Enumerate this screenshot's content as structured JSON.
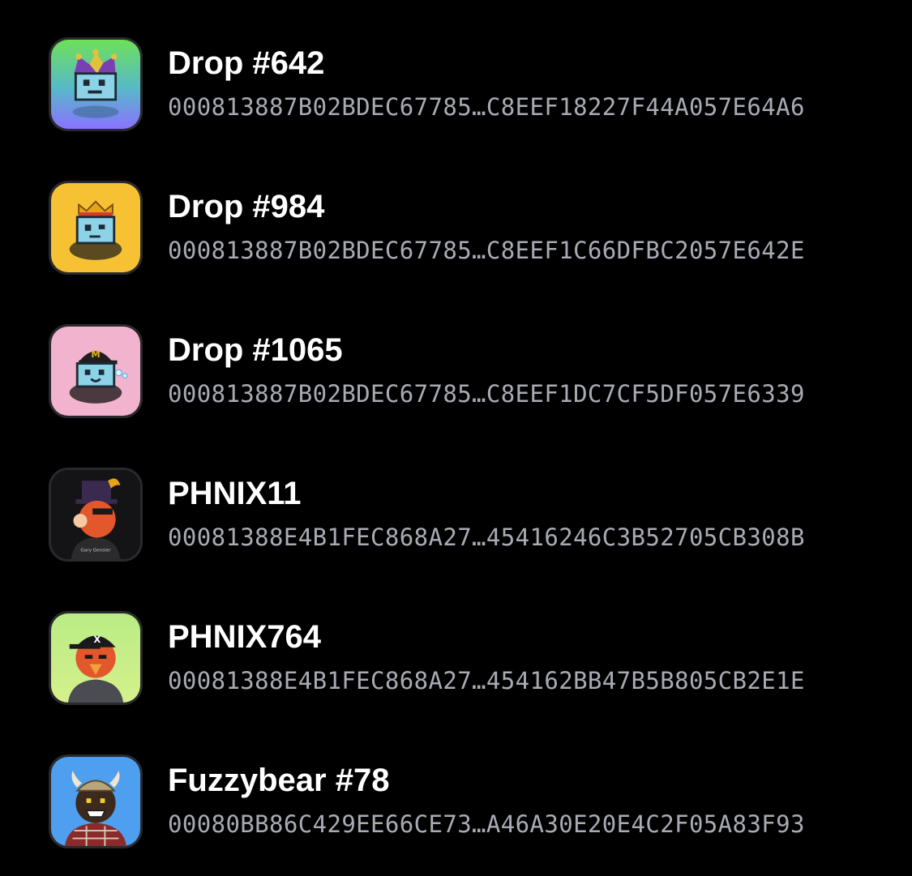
{
  "items": [
    {
      "name": "Drop #642",
      "id": "000813887B02BDEC67785…C8EEF18227F44A057E64A6",
      "icon": "jester-drop-avatar-icon",
      "bg_top": "#6ee05a",
      "bg_bottom": "#8a72ff"
    },
    {
      "name": "Drop #984",
      "id": "000813887B02BDEC67785…C8EEF1C66DFBC2057E642E",
      "icon": "king-drop-avatar-icon",
      "bg_top": "#f6c233",
      "bg_bottom": "#f6c233"
    },
    {
      "name": "Drop #1065",
      "id": "000813887B02BDEC67785…C8EEF1DC7CF5DF057E6339",
      "icon": "cap-drop-avatar-icon",
      "bg_top": "#f2b3ce",
      "bg_bottom": "#f2b3ce"
    },
    {
      "name": "PHNIX11",
      "id": "00081388E4B1FEC868A27…45416246C3B52705CB308B",
      "icon": "phoenix-top-hat-avatar-icon",
      "bg_top": "#141416",
      "bg_bottom": "#141416"
    },
    {
      "name": "PHNIX764",
      "id": "00081388E4B1FEC868A27…454162BB47B5B805CB2E1E",
      "icon": "phoenix-cap-avatar-icon",
      "bg_top": "#b9ec85",
      "bg_bottom": "#d6f08c"
    },
    {
      "name": "Fuzzybear #78",
      "id": "00080BB86C429EE66CE73…A46A30E20E4C2F05A83F93",
      "icon": "viking-bear-avatar-icon",
      "bg_top": "#4f9ff0",
      "bg_bottom": "#4f9ff0"
    }
  ]
}
